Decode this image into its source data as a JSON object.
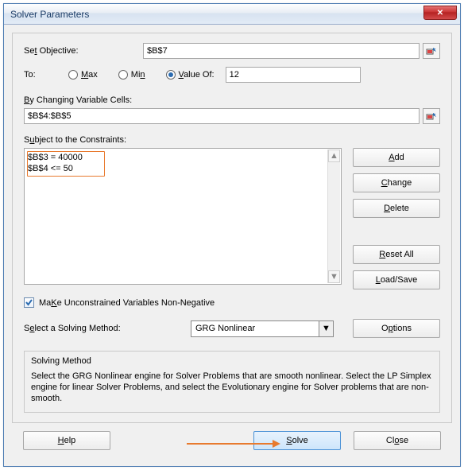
{
  "window": {
    "title": "Solver Parameters",
    "close": "✕"
  },
  "objective": {
    "label_pre": "Se",
    "label_u": "t",
    "label_post": " Objective:",
    "value": "$B$7"
  },
  "to": {
    "label": "To:",
    "max_u": "M",
    "max_post": "ax",
    "min_pre": "Mi",
    "min_u": "n",
    "value_u": "V",
    "value_post": "alue Of:",
    "value_input": "12"
  },
  "changing": {
    "u": "B",
    "post": "y Changing Variable Cells:",
    "value": "$B$4:$B$5"
  },
  "constraints": {
    "label_pre": "S",
    "label_u": "u",
    "label_post": "bject to the Constraints:",
    "items": [
      "$B$3 = 40000",
      "$B$4 <= 50"
    ],
    "buttons": {
      "add_u": "A",
      "add_post": "dd",
      "change_u": "C",
      "change_post": "hange",
      "delete_u": "D",
      "delete_post": "elete",
      "reset_u": "R",
      "reset_post": "eset All",
      "load_u": "L",
      "load_post": "oad/Save"
    }
  },
  "nonneg": {
    "u": "K",
    "pre": "Ma",
    "post": "e Unconstrained Variables Non-Negative"
  },
  "method": {
    "label_pre": "S",
    "label_u": "e",
    "label_post": "lect a Solving Method:",
    "value": "GRG Nonlinear",
    "options_pre": "O",
    "options_u": "p",
    "options_post": "tions"
  },
  "info": {
    "header": "Solving Method",
    "body": "Select the GRG Nonlinear engine for Solver Problems that are smooth nonlinear. Select the LP Simplex engine for linear Solver Problems, and select the Evolutionary engine for Solver problems that are non-smooth."
  },
  "footer": {
    "help_u": "H",
    "help_post": "elp",
    "solve_u": "S",
    "solve_post": "olve",
    "close_pre": "Cl",
    "close_u": "o",
    "close_post": "se"
  }
}
